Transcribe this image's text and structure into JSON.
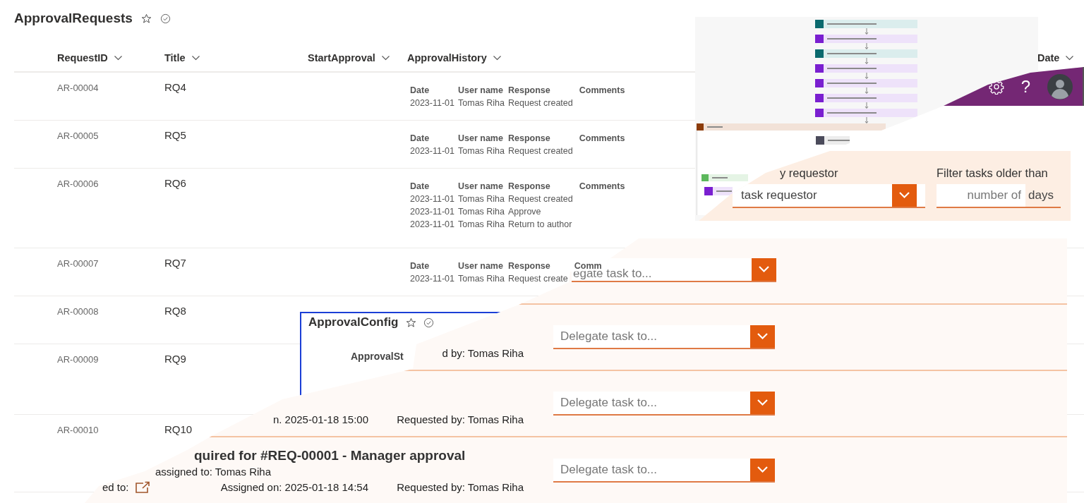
{
  "list": {
    "title": "ApprovalRequests",
    "columns": [
      {
        "label": "RequestID"
      },
      {
        "label": "Title"
      },
      {
        "label": "StartApproval"
      },
      {
        "label": "ApprovalHistory"
      },
      {
        "label": "Date"
      }
    ],
    "rows": [
      {
        "id": "AR-00004",
        "title": "RQ4",
        "history": {
          "headers": [
            "Date",
            "User name",
            "Response",
            "Comments"
          ],
          "entries": [
            [
              "2023-11-01",
              "Tomas Riha",
              "Request created"
            ]
          ]
        }
      },
      {
        "id": "AR-00005",
        "title": "RQ5",
        "history": {
          "headers": [
            "Date",
            "User name",
            "Response",
            "Comments"
          ],
          "entries": [
            [
              "2023-11-01",
              "Tomas Riha",
              "Request created"
            ]
          ]
        }
      },
      {
        "id": "AR-00006",
        "title": "RQ6",
        "history": {
          "headers": [
            "Date",
            "User name",
            "Response",
            "Comments"
          ],
          "entries": [
            [
              "2023-11-01",
              "Tomas Riha",
              "Request created"
            ],
            [
              "2023-11-01",
              "Tomas Riha",
              "Approve"
            ],
            [
              "2023-11-01",
              "Tomas Riha",
              "Return to author"
            ]
          ]
        }
      },
      {
        "id": "AR-00007",
        "title": "RQ7",
        "history": {
          "headers": [
            "Date",
            "User name",
            "Response",
            "Comm"
          ],
          "entries": [
            [
              "2023-11-01",
              "Tomas Riha",
              "Request create"
            ]
          ]
        }
      },
      {
        "id": "AR-00008",
        "title": "RQ8"
      },
      {
        "id": "AR-00009",
        "title": "RQ9"
      },
      {
        "id": "AR-00010",
        "title": "RQ10"
      }
    ]
  },
  "flow": {
    "steps": [
      {
        "kind": "sharepoint"
      },
      {
        "kind": "variable"
      },
      {
        "kind": "sharepoint"
      },
      {
        "kind": "variable"
      },
      {
        "kind": "variable"
      },
      {
        "kind": "variable"
      },
      {
        "kind": "variable"
      }
    ],
    "branch_steps": [
      {
        "kind": "variable"
      }
    ]
  },
  "app": {
    "help": "?",
    "requestor_label": "y requestor",
    "requestor_placeholder": "task requestor",
    "age_label": "Filter tasks older than",
    "age_placeholder": "number of",
    "age_unit": "days"
  },
  "config": {
    "title": "ApprovalConfig",
    "line": "ApprovalSt"
  },
  "tasks": [
    {
      "delegate": {
        "placeholder": "egate task to..."
      }
    },
    {
      "requested_by": "d by: Tomas Riha",
      "delegate": {
        "placeholder": "Delegate task to..."
      }
    },
    {
      "assigned_on": "n. 2025-01-18 15:00",
      "requested_by": "Requested by: Tomas Riha",
      "delegate": {
        "placeholder": "Delegate task to..."
      }
    },
    {
      "title": "quired for #REQ-00001 - Manager approval",
      "assignee": "assigned to: Tomas Riha",
      "assigned_to": "ed to:",
      "assigned_on": "Assigned on: 2025-01-18 14:54",
      "requested_by": "Requested by: Tomas Riha",
      "delegate": {
        "placeholder": "Delegate task to..."
      }
    }
  ]
}
